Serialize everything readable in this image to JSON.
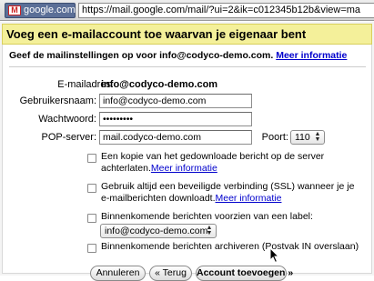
{
  "browser": {
    "site_label": "google.com",
    "url": "https://mail.google.com/mail/?ui=2&ik=c012345b12b&view=ma"
  },
  "dialog": {
    "title": "Voeg een e-mailaccount toe waarvan je eigenaar bent",
    "intro": "Geef de mailinstellingen op voor info@codyco-demo.com.",
    "more_info": "Meer informatie",
    "email_label": "E-mailadres:",
    "email_value": "info@codyco-demo.com",
    "username_label": "Gebruikersnaam:",
    "username_value": "info@codyco-demo.com",
    "password_label": "Wachtwoord:",
    "password_value": "•••••••••",
    "pop_label": "POP-server:",
    "pop_value": "mail.codyco-demo.com",
    "port_label": "Poort:",
    "port_value": "110",
    "options": [
      {
        "text_1": "Een kopie van het gedownloade bericht op de server",
        "text_2": "achterlaten.",
        "link": "Meer informatie",
        "checked": false
      },
      {
        "text_1": "Gebruik altijd een beveiligde verbinding (SSL) wanneer je je",
        "text_2": "e-mailberichten downloadt.",
        "link": "Meer informatie",
        "checked": false
      },
      {
        "text_1": "Binnenkomende berichten voorzien van een label:",
        "label_select": "info@codyco-demo.com",
        "checked": false
      },
      {
        "text_1": "Binnenkomende berichten archiveren (Postvak IN overslaan)",
        "checked": false
      }
    ],
    "buttons": {
      "cancel": "Annuleren",
      "back": "« Terug",
      "add": "Account toevoegen »"
    }
  }
}
